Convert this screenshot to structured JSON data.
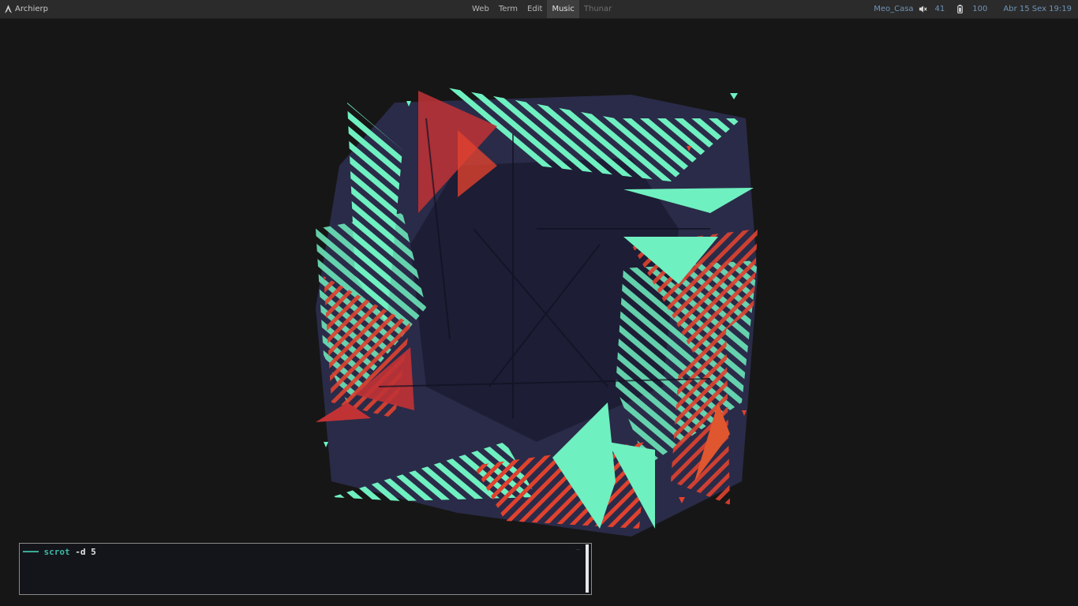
{
  "topbar": {
    "left_label": "Archierp",
    "workspaces": [
      {
        "label": "Web",
        "active": false
      },
      {
        "label": "Term",
        "active": false
      },
      {
        "label": "Edit",
        "active": false
      },
      {
        "label": "Music",
        "active": true
      },
      {
        "label": "Thunar",
        "active": false
      }
    ],
    "network": "Meo_Casa",
    "volume": "41",
    "battery": "100",
    "datetime": "Abr 15 Sex 19:19"
  },
  "terminal": {
    "command": "scrot",
    "args": "-d 5"
  },
  "colors": {
    "accent": "#3fb8a4",
    "mint": "#6ff0c0",
    "red": "#e0422e",
    "navy": "#2c2c4e",
    "status_blue": "#6f93b8"
  },
  "icons": {
    "logo": "arch-logo-icon",
    "volume": "speaker-muted-icon",
    "battery": "battery-icon"
  }
}
